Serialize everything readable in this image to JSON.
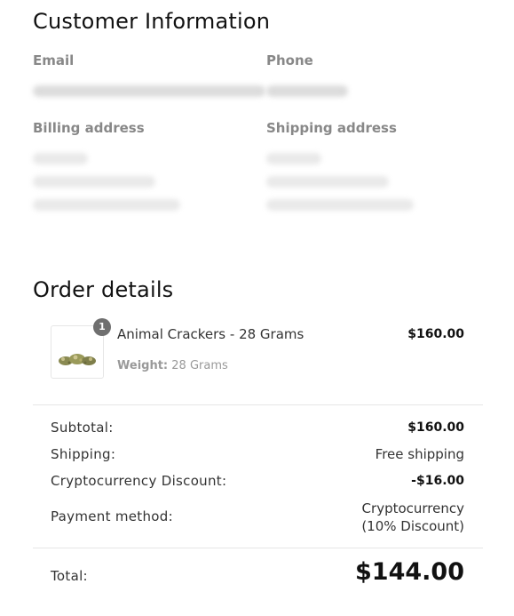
{
  "customer_info": {
    "heading": "Customer Information",
    "email_label": "Email",
    "phone_label": "Phone",
    "billing_label": "Billing address",
    "shipping_label": "Shipping address"
  },
  "order": {
    "heading": "Order details",
    "item": {
      "quantity": "1",
      "name": "Animal Crackers - 28 Grams",
      "price": "$160.00",
      "weight_label": "Weight:",
      "weight_value": "28 Grams"
    },
    "summary": {
      "subtotal_label": "Subtotal:",
      "subtotal_value": "$160.00",
      "shipping_label": "Shipping:",
      "shipping_value": "Free shipping",
      "discount_label": "Cryptocurrency Discount:",
      "discount_value": "-$16.00",
      "payment_label": "Payment method:",
      "payment_value_line1": "Cryptocurrency",
      "payment_value_line2": "(10% Discount)",
      "total_label": "Total:",
      "total_value": "$144.00"
    }
  }
}
